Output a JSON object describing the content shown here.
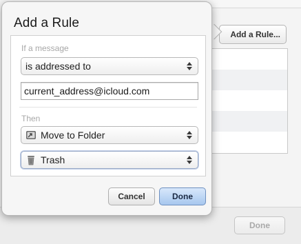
{
  "dialog": {
    "title": "Add a Rule",
    "condition_label": "If a message",
    "condition_select": "is addressed to",
    "condition_value": "current_address@icloud.com",
    "action_label": "Then",
    "action_select": "Move to Folder",
    "folder_select": "Trash",
    "cancel_label": "Cancel",
    "done_label": "Done"
  },
  "background": {
    "add_rule_label": "Add a Rule...",
    "done_label": "Done"
  },
  "colors": {
    "done_button_top": "#d8e8fb",
    "done_button_bottom": "#a7c7ee",
    "section_label": "#a7a7a7"
  },
  "icons": {
    "action_icon": "folder-move-icon",
    "folder_icon": "trash-icon"
  }
}
